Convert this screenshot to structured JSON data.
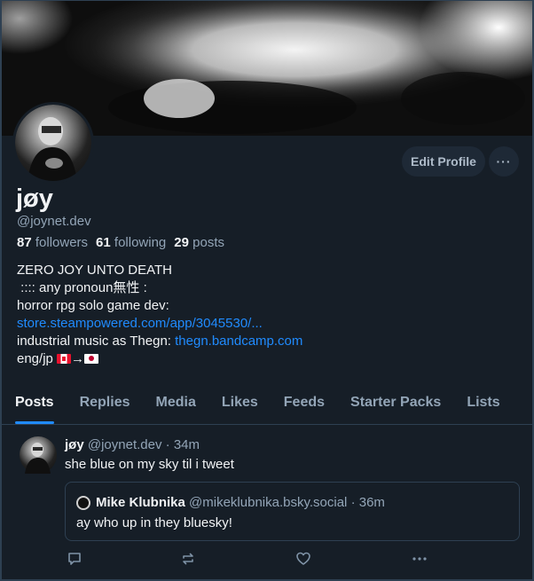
{
  "profile": {
    "display_name": "jøy",
    "handle": "@joynet.dev",
    "followers_count": "87",
    "followers_label": "followers",
    "following_count": "61",
    "following_label": "following",
    "posts_count": "29",
    "posts_label": "posts",
    "edit_button": "Edit Profile",
    "more_button": "···"
  },
  "bio": {
    "line1": "ZERO JOY UNTO DEATH",
    "line2": " :::: any pronoun無性 :",
    "line3": "horror rpg solo game dev:",
    "line4_link": "store.steampowered.com/app/3045530/...",
    "line5_text": "industrial music as Thegn: ",
    "line5_link": "thegn.bandcamp.com",
    "line6_text": "eng/jp ",
    "line6_arrow": "→"
  },
  "tabs": [
    {
      "label": "Posts",
      "active": true
    },
    {
      "label": "Replies"
    },
    {
      "label": "Media"
    },
    {
      "label": "Likes"
    },
    {
      "label": "Feeds"
    },
    {
      "label": "Starter Packs"
    },
    {
      "label": "Lists"
    }
  ],
  "post": {
    "author_name": "jøy",
    "author_handle": "@joynet.dev",
    "separator": "·",
    "time": "34m",
    "text": "she blue on my sky til i tweet",
    "quote": {
      "author_name": "Mike Klubnika",
      "author_handle": "@mikeklubnika.bsky.social",
      "time": "36m",
      "text": "ay who up in they bluesky!"
    },
    "actions": [
      "reply-icon",
      "repost-icon",
      "like-icon",
      "more-icon"
    ]
  },
  "colors": {
    "background": "#161e27",
    "accent": "#208bfe",
    "muted_text": "#93a5b7"
  }
}
